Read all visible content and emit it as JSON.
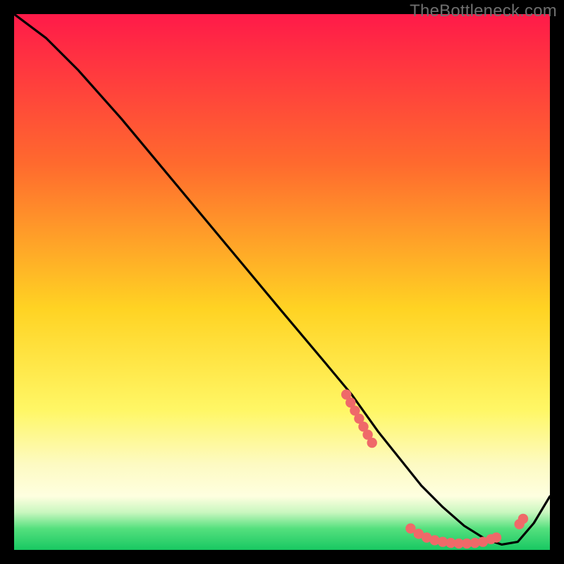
{
  "watermark": "TheBottleneck.com",
  "colors": {
    "curve": "#000000",
    "dots": "#ef6969",
    "grad_top": "#ff1a49",
    "grad_mid1": "#ff7a2e",
    "grad_mid2": "#ffd323",
    "grad_band_lt": "#fdfac2",
    "grad_green_top": "#c9f7bf",
    "grad_green_mid": "#55e07e",
    "grad_green_bot": "#18c862"
  },
  "chart_data": {
    "type": "line",
    "title": "",
    "xlabel": "",
    "ylabel": "",
    "xlim": [
      0,
      100
    ],
    "ylim": [
      0,
      100
    ],
    "series": [
      {
        "name": "bottleneck-curve",
        "x": [
          0,
          6,
          12,
          20,
          30,
          40,
          50,
          58,
          63,
          68,
          72,
          76,
          80,
          84,
          88,
          91,
          94,
          97,
          100
        ],
        "y": [
          100,
          95.5,
          89.5,
          80.5,
          68.5,
          56.5,
          44.5,
          35,
          29,
          22,
          17,
          12,
          8,
          4.5,
          2,
          1,
          1.5,
          5,
          10
        ]
      }
    ],
    "dot_groups": [
      {
        "name": "left-cluster",
        "points": [
          [
            62.0,
            29.0
          ],
          [
            62.8,
            27.5
          ],
          [
            63.6,
            26.0
          ],
          [
            64.4,
            24.5
          ],
          [
            65.2,
            23.0
          ],
          [
            66.0,
            21.5
          ],
          [
            66.8,
            20.0
          ]
        ]
      },
      {
        "name": "bottom-cluster",
        "points": [
          [
            74.0,
            4.0
          ],
          [
            75.5,
            3.0
          ],
          [
            77.0,
            2.3
          ],
          [
            78.5,
            1.8
          ],
          [
            80.0,
            1.5
          ],
          [
            81.5,
            1.3
          ],
          [
            83.0,
            1.2
          ],
          [
            84.5,
            1.2
          ],
          [
            86.0,
            1.3
          ],
          [
            87.5,
            1.5
          ],
          [
            89.0,
            2.0
          ],
          [
            90.0,
            2.3
          ]
        ]
      },
      {
        "name": "right-cluster",
        "points": [
          [
            94.3,
            4.8
          ],
          [
            95.0,
            5.8
          ]
        ]
      }
    ]
  }
}
